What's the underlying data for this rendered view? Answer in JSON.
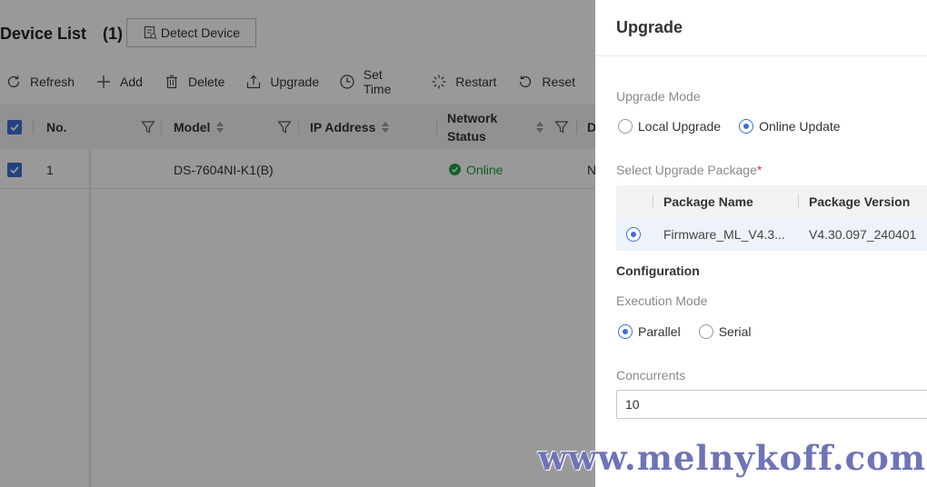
{
  "device_list": {
    "title": "Device List",
    "count": "(1)",
    "detect_button": "Detect Device",
    "toolbar": {
      "refresh": "Refresh",
      "add": "Add",
      "delete": "Delete",
      "upgrade": "Upgrade",
      "set_time": "Set Time",
      "restart": "Restart",
      "reset": "Reset"
    },
    "columns": {
      "no": "No.",
      "model": "Model",
      "ip": "IP Address",
      "network_status_1": "Network",
      "network_status_2": "Status",
      "next": "D"
    },
    "rows": [
      {
        "no": "1",
        "model": "DS-7604NI-K1(B)",
        "status": "Online",
        "next": "N"
      }
    ]
  },
  "upgrade_panel": {
    "title": "Upgrade",
    "upgrade_mode_label": "Upgrade Mode",
    "mode_local": "Local Upgrade",
    "mode_online": "Online Update",
    "package_label": "Select Upgrade Package",
    "required_mark": "*",
    "package_columns": {
      "name": "Package Name",
      "version": "Package Version"
    },
    "packages": [
      {
        "name": "Firmware_ML_V4.3...",
        "version": "V4.30.097_240401"
      }
    ],
    "configuration_title": "Configuration",
    "execution_mode_label": "Execution Mode",
    "exec_parallel": "Parallel",
    "exec_serial": "Serial",
    "concurrents_label": "Concurrents",
    "concurrents_value": "10"
  },
  "watermark": "www.melnykoff.com",
  "colors": {
    "accent": "#3b6fd4",
    "online": "#23a03f",
    "required": "#e03a3a"
  }
}
